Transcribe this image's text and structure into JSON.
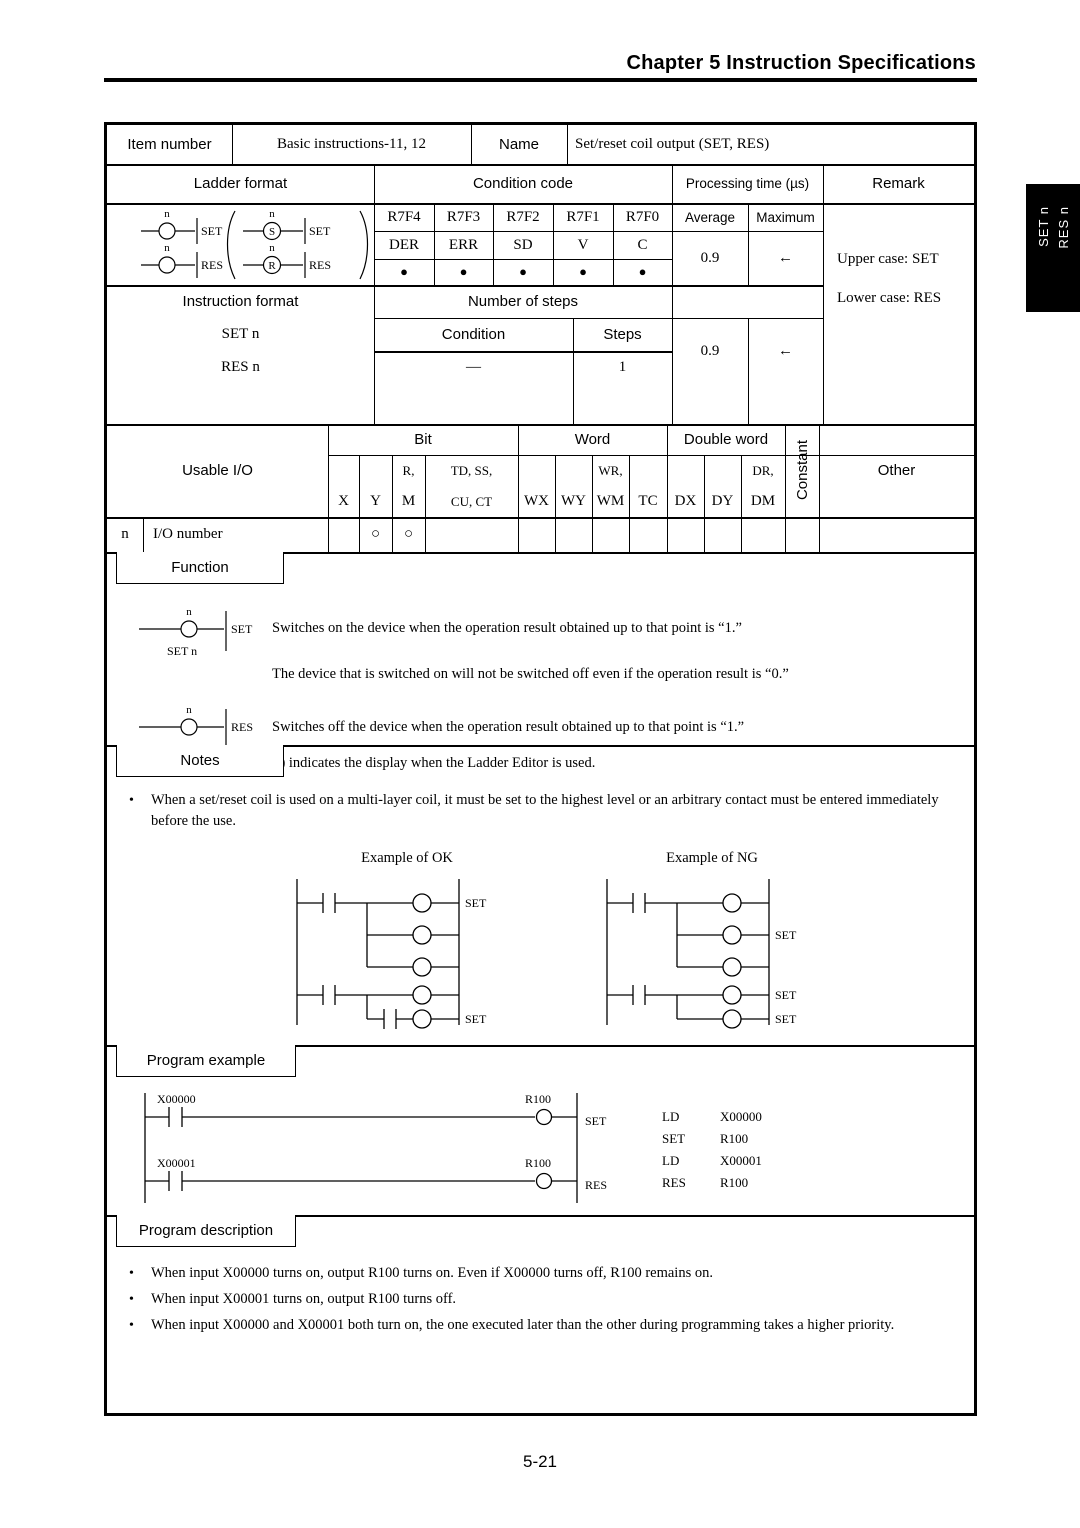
{
  "header": {
    "chapter": "Chapter 5  Instruction Specifications"
  },
  "side_tab": {
    "line1": "SET  n",
    "line2": "RES  n"
  },
  "footer": {
    "page_number": "5-21"
  },
  "info_table": {
    "item_number_label": "Item number",
    "item_number_value": "Basic instructions-11, 12",
    "name_label": "Name",
    "name_value": "Set/reset coil output (SET, RES)",
    "ladder_format_label": "Ladder format",
    "condition_code_label": "Condition code",
    "processing_time_label": "Processing time (µs)",
    "remark_label": "Remark",
    "condition_codes": [
      "R7F4",
      "R7F3",
      "R7F2",
      "R7F1",
      "R7F0"
    ],
    "condition_flags": [
      "DER",
      "ERR",
      "SD",
      "V",
      "C"
    ],
    "condition_marks": [
      "●",
      "●",
      "●",
      "●",
      "●"
    ],
    "average_label": "Average",
    "maximum_label": "Maximum",
    "average_value_1": "0.9",
    "maximum_value_1": "←",
    "remark_line1": "Upper case: SET",
    "remark_line2": "Lower case: RES",
    "instruction_format_label": "Instruction format",
    "instruction_format_lines": [
      "SET  n",
      "RES  n"
    ],
    "number_of_steps_label": "Number of steps",
    "condition_label": "Condition",
    "steps_label": "Steps",
    "condition_value": "—",
    "steps_value": "1",
    "average_value_2": "0.9",
    "maximum_value_2": "←",
    "ladder_diagram": {
      "coil_label_n": "n",
      "set_label": "SET",
      "res_label": "RES",
      "editor_set_symbol": "S",
      "editor_res_symbol": "R"
    }
  },
  "usable_io": {
    "title": "Usable I/O",
    "group_bit": "Bit",
    "group_word": "Word",
    "group_double_word": "Double word",
    "constant_label": "Constant",
    "other_label": "Other",
    "bit_cols": [
      {
        "top": "",
        "bottom": "X"
      },
      {
        "top": "",
        "bottom": "Y"
      },
      {
        "top": "R,",
        "bottom": "M"
      },
      {
        "top": "TD, SS,",
        "bottom": "CU, CT"
      }
    ],
    "word_cols": [
      {
        "top": "",
        "bottom": "WX"
      },
      {
        "top": "",
        "bottom": "WY"
      },
      {
        "top": "WR,",
        "bottom": "WM"
      },
      {
        "top": "",
        "bottom": "TC"
      }
    ],
    "dword_cols": [
      {
        "top": "",
        "bottom": "DX"
      },
      {
        "top": "",
        "bottom": "DY"
      },
      {
        "top": "DR,",
        "bottom": "DM"
      }
    ],
    "row": {
      "operand": "n",
      "description": "I/O number",
      "marks": {
        "X": "",
        "Y": "○",
        "RM": "○",
        "TDSS": "",
        "WX": "",
        "WY": "",
        "WRWM": "",
        "TC": "",
        "DX": "",
        "DY": "",
        "DRDM": "",
        "constant": "",
        "other": ""
      }
    }
  },
  "function": {
    "tab_label": "Function",
    "set_diagram_caption": "SET n",
    "set_coil_n": "n",
    "set_coil_label": "SET",
    "res_diagram_caption": "RES n",
    "res_coil_n": "n",
    "res_coil_label": "RES",
    "text_1": "Switches on the device when the operation result obtained up to that point is “1.”",
    "text_2": "The device that is switched on will not be switched off even if the operation result is “0.”",
    "text_3": "Switches off the device when the operation result obtained up to that point is “1.”",
    "text_4": "(  ) indicates the display when the Ladder Editor is used."
  },
  "notes": {
    "tab_label": "Notes",
    "bullets": [
      "When a set/reset coil is used on a multi-layer coil, it must be set to the highest level or an arbitrary contact must be entered immediately before the use."
    ],
    "example_ok_label": "Example of OK",
    "example_ng_label": "Example of NG",
    "example_ok_coil_labels": [
      "SET",
      "",
      "",
      "",
      "SET"
    ],
    "example_ng_coil_labels": [
      "",
      "SET",
      "",
      "SET",
      "SET"
    ]
  },
  "program_example": {
    "tab_label": "Program example",
    "rung1": {
      "contact": "X00000",
      "coil": "R100",
      "instruction": "SET"
    },
    "rung2": {
      "contact": "X00001",
      "coil": "R100",
      "instruction": "RES"
    },
    "mnemonics": [
      {
        "op": "LD",
        "operand": "X00000"
      },
      {
        "op": "SET",
        "operand": "R100"
      },
      {
        "op": "LD",
        "operand": "X00001"
      },
      {
        "op": "RES",
        "operand": "R100"
      }
    ]
  },
  "program_description": {
    "tab_label": "Program description",
    "bullets": [
      "When input X00000 turns on, output R100 turns on.  Even if X00000 turns off, R100 remains on.",
      "When input X00001 turns on, output R100 turns off.",
      "When input X00000 and X00001 both turn on, the one executed later than the other during programming takes a higher priority."
    ]
  }
}
